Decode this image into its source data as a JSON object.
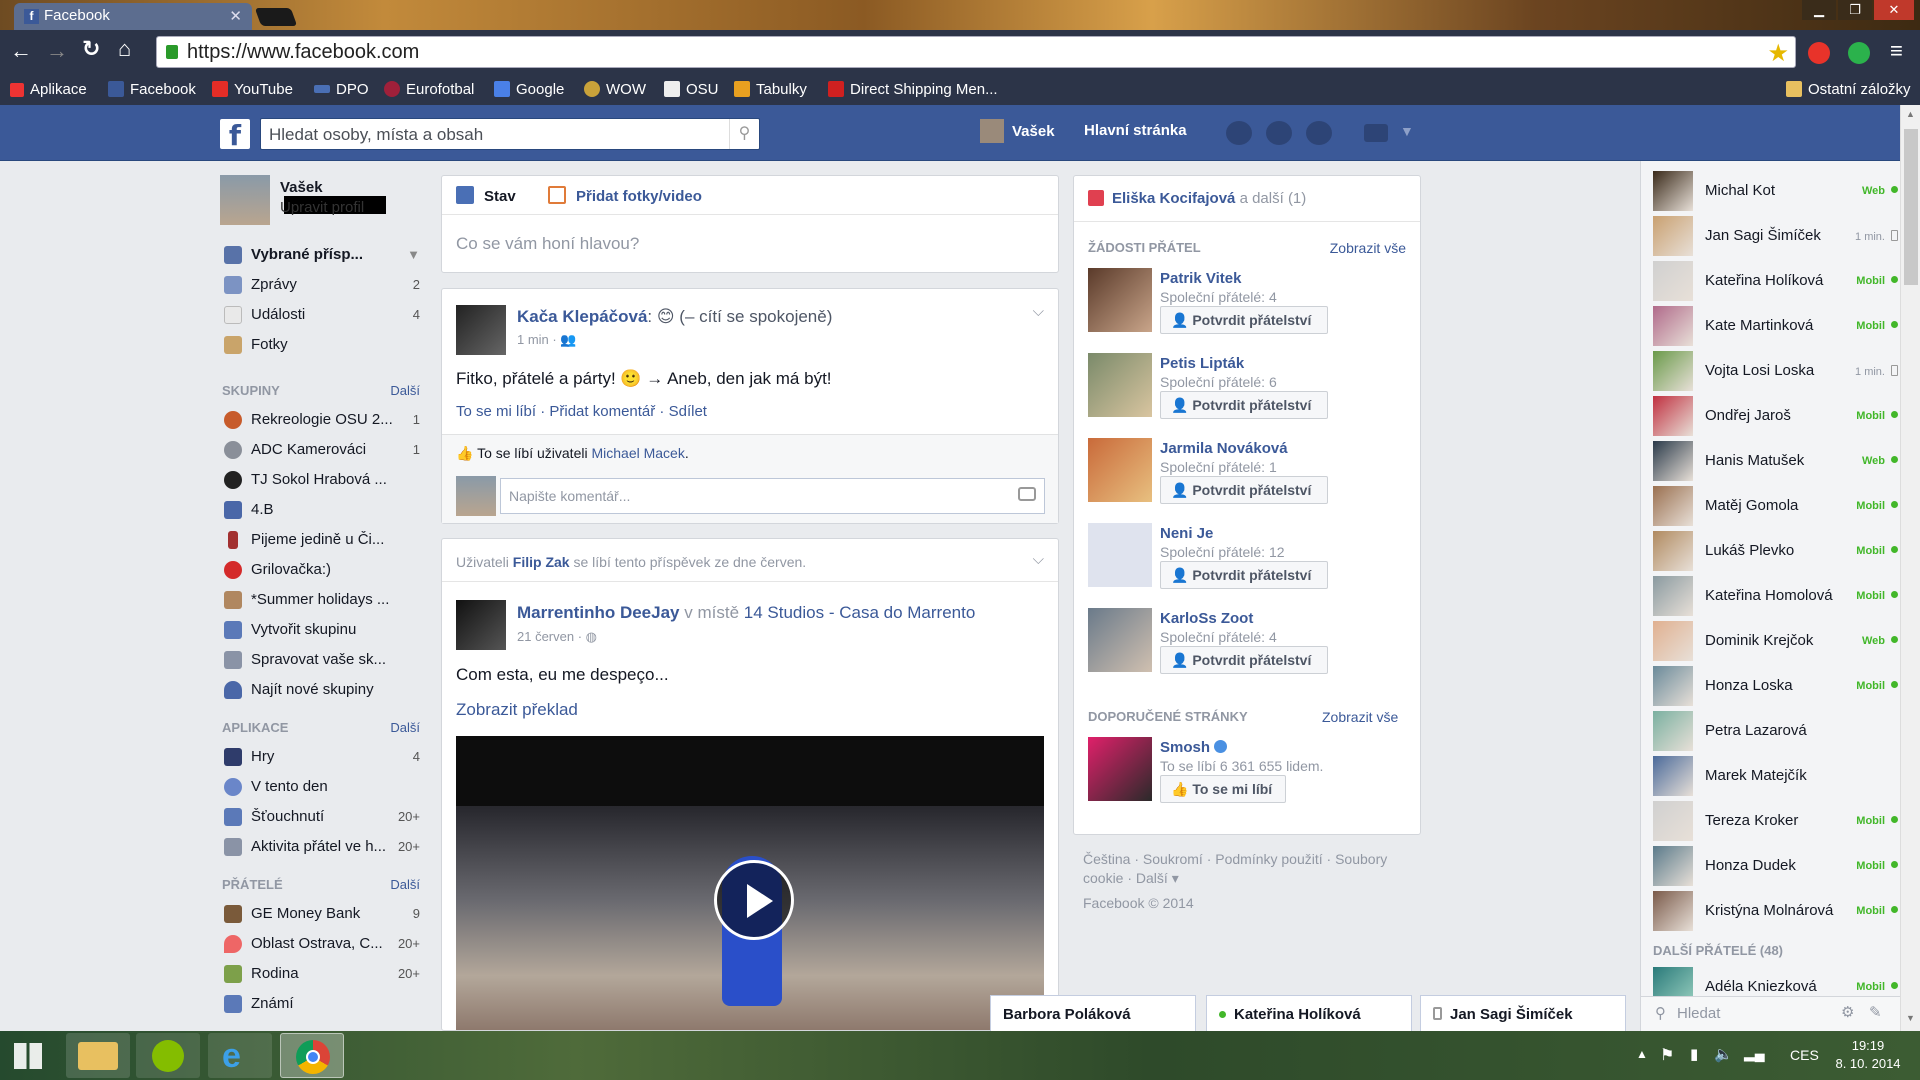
{
  "browser": {
    "tab_title": "Facebook",
    "url": "https://www.facebook.com",
    "bookmarks": [
      "Aplikace",
      "Facebook",
      "YouTube",
      "DPO",
      "Eurofotbal",
      "Google",
      "WOW",
      "OSU",
      "Tabulky",
      "Direct Shipping Men..."
    ],
    "other_bookmarks": "Ostatní záložky"
  },
  "fbbar": {
    "search_placeholder": "Hledat osoby, místa a obsah",
    "user": "Vašek",
    "home": "Hlavní stránka"
  },
  "left": {
    "name": "Vašek",
    "edit": "Upravit profil",
    "favorites": [
      {
        "label": "Vybrané přísp...",
        "count": ""
      },
      {
        "label": "Zprávy",
        "count": "2"
      },
      {
        "label": "Události",
        "count": "4"
      },
      {
        "label": "Fotky",
        "count": ""
      }
    ],
    "groups_head": "SKUPINY",
    "more": "Další",
    "groups": [
      {
        "label": "Rekreologie OSU 2...",
        "count": "1"
      },
      {
        "label": "ADC Kamerováci",
        "count": "1"
      },
      {
        "label": "TJ Sokol Hrabová ...",
        "count": ""
      },
      {
        "label": "4.B",
        "count": ""
      },
      {
        "label": "Pijeme jedině u Či...",
        "count": ""
      },
      {
        "label": "Grilovačka:)",
        "count": ""
      },
      {
        "label": "*Summer holidays ...",
        "count": ""
      },
      {
        "label": "Vytvořit skupinu",
        "count": ""
      },
      {
        "label": "Spravovat vaše sk...",
        "count": ""
      },
      {
        "label": "Najít nové skupiny",
        "count": ""
      }
    ],
    "apps_head": "APLIKACE",
    "apps": [
      {
        "label": "Hry",
        "count": "4"
      },
      {
        "label": "V tento den",
        "count": ""
      },
      {
        "label": "Šťouchnutí",
        "count": "20+"
      },
      {
        "label": "Aktivita přátel ve h...",
        "count": "20+"
      }
    ],
    "friends_head": "PŘÁTELÉ",
    "friends": [
      {
        "label": "GE Money Bank",
        "count": "9"
      },
      {
        "label": "Oblast Ostrava, C...",
        "count": "20+"
      },
      {
        "label": "Rodina",
        "count": "20+"
      },
      {
        "label": "Známí",
        "count": ""
      }
    ]
  },
  "composer": {
    "tab_status": "Stav",
    "tab_photo": "Přidat fotky/video",
    "placeholder": "Co se vám honí hlavou?"
  },
  "post1": {
    "author": "Kača Klepáčová",
    "feeling": ": 😊 (– cítí se spokojeně)",
    "time": "1 min",
    "text": "Fitko, přátelé a párty! 🙂 → Aneb, den jak má být!",
    "like": "To se mi líbí",
    "comment": "Přidat komentář",
    "share": "Sdílet",
    "likes_prefix": "To se líbí uživateli",
    "likes_user": "Michael Macek",
    "likes_suffix": ".",
    "comment_placeholder": "Napište komentář..."
  },
  "post2": {
    "story_prefix": "Uživateli",
    "story_user": "Filip Zak",
    "story_suffix": "se líbí tento příspěvek ze dne červen.",
    "author": "Marrentinho DeeJay",
    "place_prefix": "v místě",
    "place": "14 Studios - Casa do Marrento",
    "time": "21 červen",
    "text": "Com esta, eu me despeço...",
    "translate": "Zobrazit překlad"
  },
  "right": {
    "notif_user": "Eliška Kocifajová",
    "notif_suffix": "a další (1)",
    "requests_head": "ŽÁDOSTI PŘÁTEL",
    "see_all": "Zobrazit vše",
    "confirm": "Potvrdit přátelství",
    "requests": [
      {
        "name": "Patrik Vitek",
        "mutual": "Společní přátelé: 4"
      },
      {
        "name": "Petis Lipták",
        "mutual": "Společní přátelé: 6"
      },
      {
        "name": "Jarmila Nováková",
        "mutual": "Společní přátelé: 1"
      },
      {
        "name": "Neni Je",
        "mutual": "Společní přátelé: 12"
      },
      {
        "name": "KarloSs Zoot",
        "mutual": "Společní přátelé: 4"
      }
    ],
    "pages_head": "DOPORUČENÉ STRÁNKY",
    "page_name": "Smosh",
    "page_likes": "To se líbí 6 361 655 lidem.",
    "page_like_btn": "To se mi líbí",
    "footer1": "Čeština · Soukromí · Podmínky použití · Soubory",
    "footer2": "cookie · Další ▾",
    "copyright": "Facebook © 2014"
  },
  "chat": {
    "friends": [
      {
        "name": "Michal Kot",
        "status": "Web"
      },
      {
        "name": "Jan Sagi Šimíček",
        "status": "1 min."
      },
      {
        "name": "Kateřina Holíková",
        "status": "Mobil"
      },
      {
        "name": "Kate Martinková",
        "status": "Mobil"
      },
      {
        "name": "Vojta Losi Loska",
        "status": "1 min."
      },
      {
        "name": "Ondřej Jaroš",
        "status": "Mobil"
      },
      {
        "name": "Hanis Matušek",
        "status": "Web"
      },
      {
        "name": "Matěj Gomola",
        "status": "Mobil"
      },
      {
        "name": "Lukáš Plevko",
        "status": "Mobil"
      },
      {
        "name": "Kateřina Homolová",
        "status": "Mobil"
      },
      {
        "name": "Dominik Krejčok",
        "status": "Web"
      },
      {
        "name": "Honza Loska",
        "status": "Mobil"
      },
      {
        "name": "Petra Lazarová",
        "status": ""
      },
      {
        "name": "Marek Matejčík",
        "status": ""
      },
      {
        "name": "Tereza Kroker",
        "status": "Mobil"
      },
      {
        "name": "Honza Dudek",
        "status": "Mobil"
      },
      {
        "name": "Kristýna Molnárová",
        "status": "Mobil"
      }
    ],
    "more_head": "DALŠÍ PŘÁTELÉ (48)",
    "more_friend": {
      "name": "Adéla Kniezková",
      "status": "Mobil"
    },
    "search": "Hledat"
  },
  "chat_tabs": [
    "Barbora Poláková",
    "Kateřina Holíková",
    "Jan Sagi Šimíček"
  ],
  "taskbar": {
    "lang": "CES",
    "time": "19:19",
    "date": "8. 10. 2014"
  }
}
